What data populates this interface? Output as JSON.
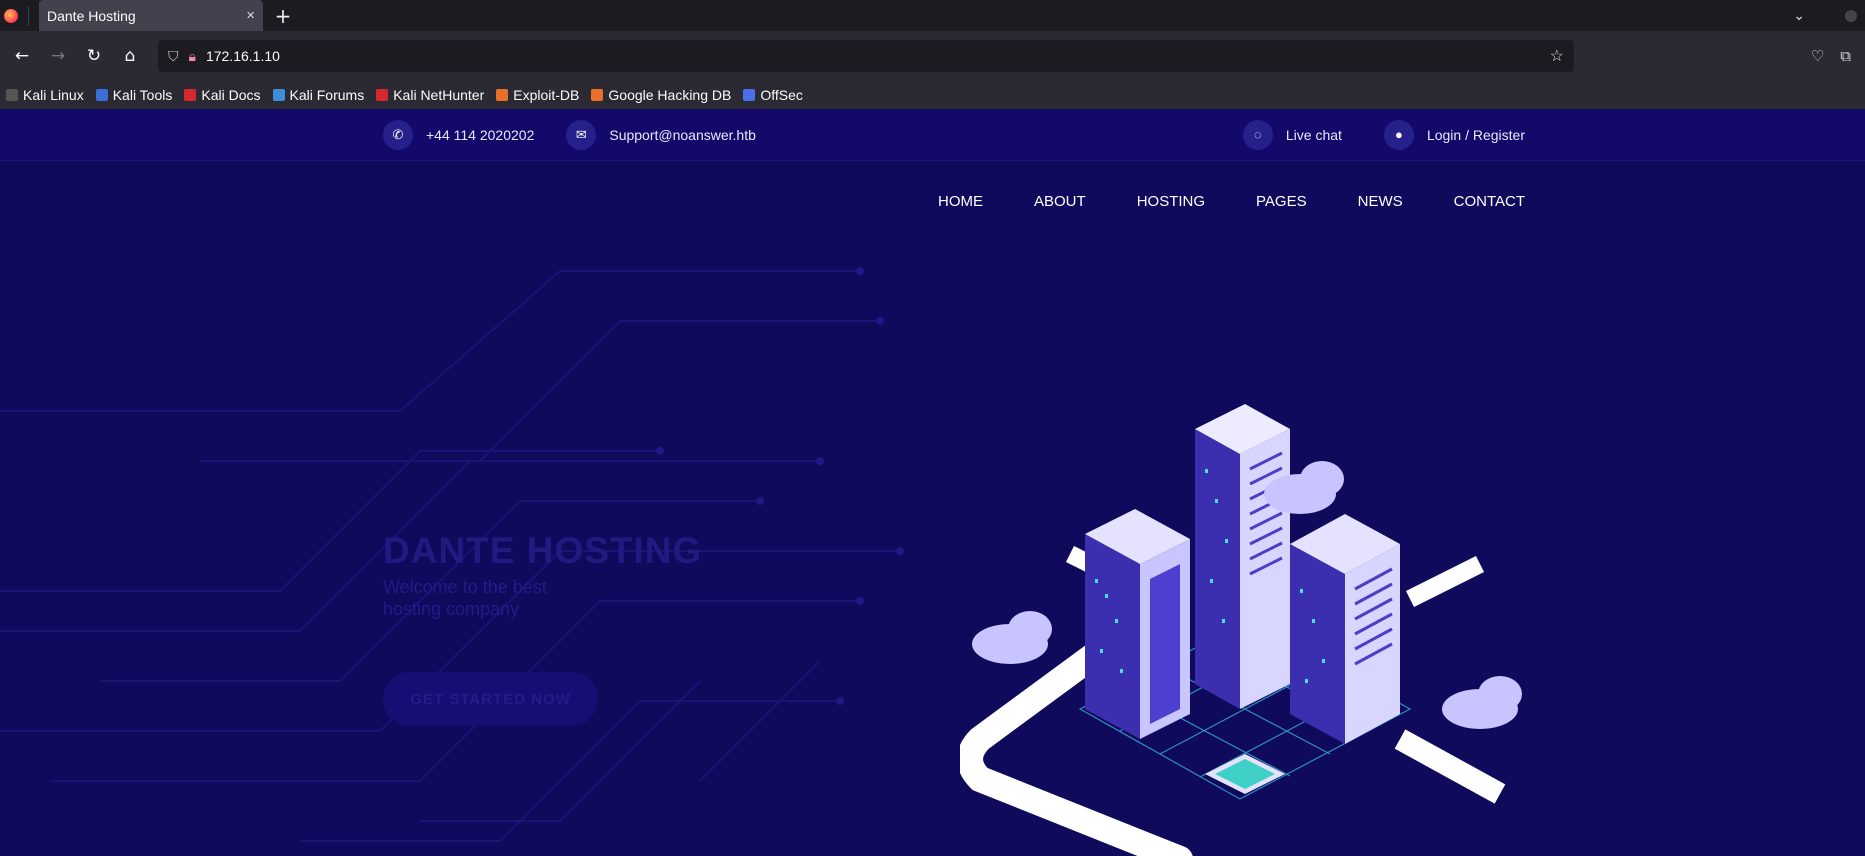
{
  "browser": {
    "tab_title": "Dante Hosting",
    "tab_close": "×",
    "new_tab": "+",
    "url": "172.16.1.10",
    "bookmarks": [
      {
        "label": "Kali Linux",
        "color": "#2b2a33"
      },
      {
        "label": "Kali Tools",
        "color": "#3b6fd8"
      },
      {
        "label": "Kali Docs",
        "color": "#d8282e"
      },
      {
        "label": "Kali Forums",
        "color": "#3b8fd8"
      },
      {
        "label": "Kali NetHunter",
        "color": "#d8282e"
      },
      {
        "label": "Exploit-DB",
        "color": "#e8702a"
      },
      {
        "label": "Google Hacking DB",
        "color": "#e8702a"
      },
      {
        "label": "OffSec",
        "color": "#4a6fe8"
      }
    ]
  },
  "site": {
    "phone": "+44 114 2020202",
    "email": "Support@noanswer.htb",
    "live_chat": "Live chat",
    "login": "Login / Register",
    "nav": [
      "HOME",
      "ABOUT",
      "HOSTING",
      "PAGES",
      "NEWS",
      "CONTACT"
    ],
    "hero_title": "DANTE HOSTING",
    "hero_subtitle": "Welcome to the best hosting company",
    "cta": "GET STARTED NOW",
    "colors": {
      "background": "#0f0a5c",
      "accent": "#4c56e8"
    }
  }
}
